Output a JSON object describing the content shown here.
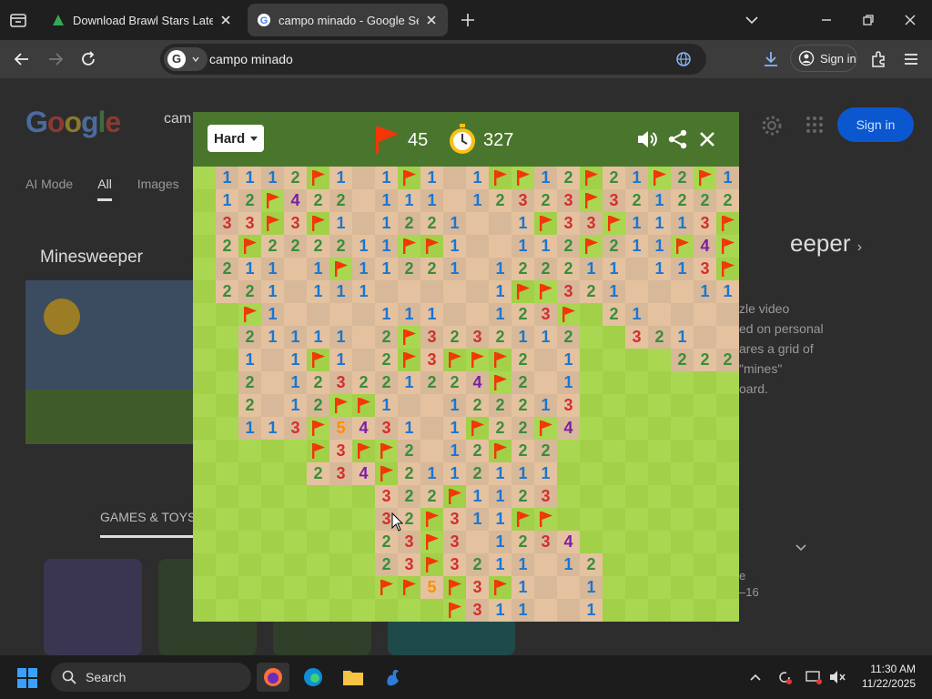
{
  "browser": {
    "tabs": [
      {
        "title": "Download Brawl Stars Latest Ve",
        "active": false
      },
      {
        "title": "campo minado - Google Search",
        "active": true
      }
    ],
    "address": "campo minado",
    "sign_in": "Sign in"
  },
  "google": {
    "logo": "Google",
    "query": "cam",
    "sign_in": "Sign in",
    "tabs": [
      "AI Mode",
      "All",
      "Images"
    ],
    "knowledge_title": "Minesweeper",
    "knowledge_right": "eeper",
    "desc_lines": [
      "zle video",
      "ed on personal",
      "ares a grid of",
      "\"mines\"",
      "oard."
    ],
    "section": "GAMES & TOYS",
    "right_meta": [
      "e",
      "–16"
    ]
  },
  "game": {
    "difficulty": "Hard",
    "flags_left": "45",
    "time": "327",
    "colors": {
      "light_unrevealed": "#aad751",
      "dark_unrevealed": "#a2d149",
      "light_revealed": "#e5c29f",
      "dark_revealed": "#d7b899",
      "flag": "#f23607"
    },
    "number_colors": {
      "1": "#1976d2",
      "2": "#388e3c",
      "3": "#d32f2f",
      "4": "#7b1fa2",
      "5": "#ff8f00"
    },
    "rows": [
      ". 1 1 1 2 F 1 _ 1 F 1 _ 1 F F 1 2 F 2 1 F 2 F 1",
      ". 1 2 F 4 2 2 _ 1 1 1 _ 1 2 3 2 3 F 3 2 1 2 2 2",
      ". 3 3 F 3 F 1 _ 1 2 2 1 _ _ 1 F 3 3 F 1 1 1 3 F",
      ". 2 F 2 2 2 2 1 1 F F 1 _ _ 1 1 2 F 2 1 1 F 4 F",
      ". 2 1 1 _ 1 F 1 1 2 2 1 _ 1 2 2 2 1 1 _ 1 1 3 F",
      ". 2 2 1 _ 1 1 1 _ _ _ _ _ 1 F F 3 2 1 _ _ _ 1 1",
      ". . F 1 _ _ _ _ 1 1 1 _ _ 1 2 3 F . 2 1 _ _ _ _",
      ". . 2 1 1 1 1 _ 2 F 3 2 3 2 1 1 2 . . 3 2 1 _ _",
      ". . 1 _ 1 F 1 _ 2 F 3 F F F 2 _ 1 . . . . 2 2 2",
      ". . 2 _ 1 2 3 2 2 1 2 2 4 F 2 _ 1 . . . . . . .",
      ". . 2 _ 1 2 F F 1 _ _ 1 2 2 2 1 3 . . . . . . .",
      ". . 1 1 3 F 5 4 3 1 _ 1 F 2 2 F 4 . . . . . . .",
      ". . . . . F 3 F F 2 _ 1 2 F 2 2 . . . . . . . .",
      ". . . . . 2 3 4 F 2 1 1 2 1 1 1 . . . . . . . .",
      ". . . . . . . . 3 2 2 F 1 1 2 3 . . . . . . . .",
      ". . . . . . . . 3 2 F 3 1 1 F F . . . . . . . .",
      ". . . . . . . . 2 3 F 3 _ 1 2 3 4 . . . . . . .",
      ". . . . . . . . 2 3 F 3 2 1 1 _ 1 2 . . . . . .",
      ". . . . . . . . F F 5 F 3 F 1 _ _ 1 . . . . . .",
      ". . . . . . . . . . . F 3 1 1 _ _ 1 . . . . . ."
    ]
  },
  "taskbar": {
    "search": "Search",
    "time": "11:30 AM",
    "date": "11/22/2025"
  }
}
